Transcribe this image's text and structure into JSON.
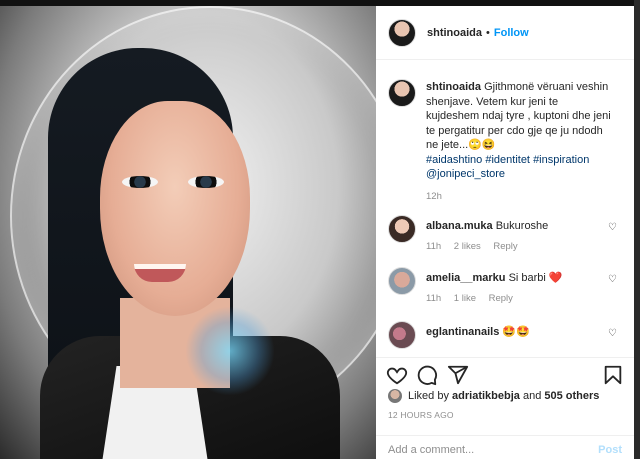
{
  "header": {
    "username": "shtinoaida",
    "separator": "•",
    "follow_label": "Follow"
  },
  "caption": {
    "username": "shtinoaida",
    "text": "Gjithmonë vëruani veshin shenjave. Vetem kur jeni te kujdeshem ndaj tyre , kuptoni dhe jeni te pergatitur per cdo gje qe ju ndodh ne jete...🙄😆",
    "tags": [
      "#aidashtino",
      "#identitet",
      "#inspiration",
      "@jonipeci_store"
    ],
    "time": "12h"
  },
  "comments": [
    {
      "username": "albana.muka",
      "text": "Bukuroshe",
      "time": "11h",
      "likes": "2 likes",
      "reply": "Reply"
    },
    {
      "username": "amelia__marku",
      "text": "Si barbi",
      "emoji": "❤️",
      "time": "11h",
      "likes": "1 like",
      "reply": "Reply"
    },
    {
      "username": "eglantinanails",
      "text": "",
      "emoji": "🤩🤩"
    }
  ],
  "likes": {
    "prefix": "Liked by",
    "user": "adriatikbebja",
    "and": "and",
    "others": "505 others"
  },
  "timestamp": "12 HOURS AGO",
  "add_comment": {
    "placeholder": "Add a comment...",
    "post_label": "Post"
  },
  "icons": [
    "heart-icon",
    "comment-icon",
    "share-icon",
    "bookmark-icon"
  ],
  "colors": {
    "link": "#0095f6",
    "tag": "#00376b",
    "like_red": "#ed4956"
  }
}
